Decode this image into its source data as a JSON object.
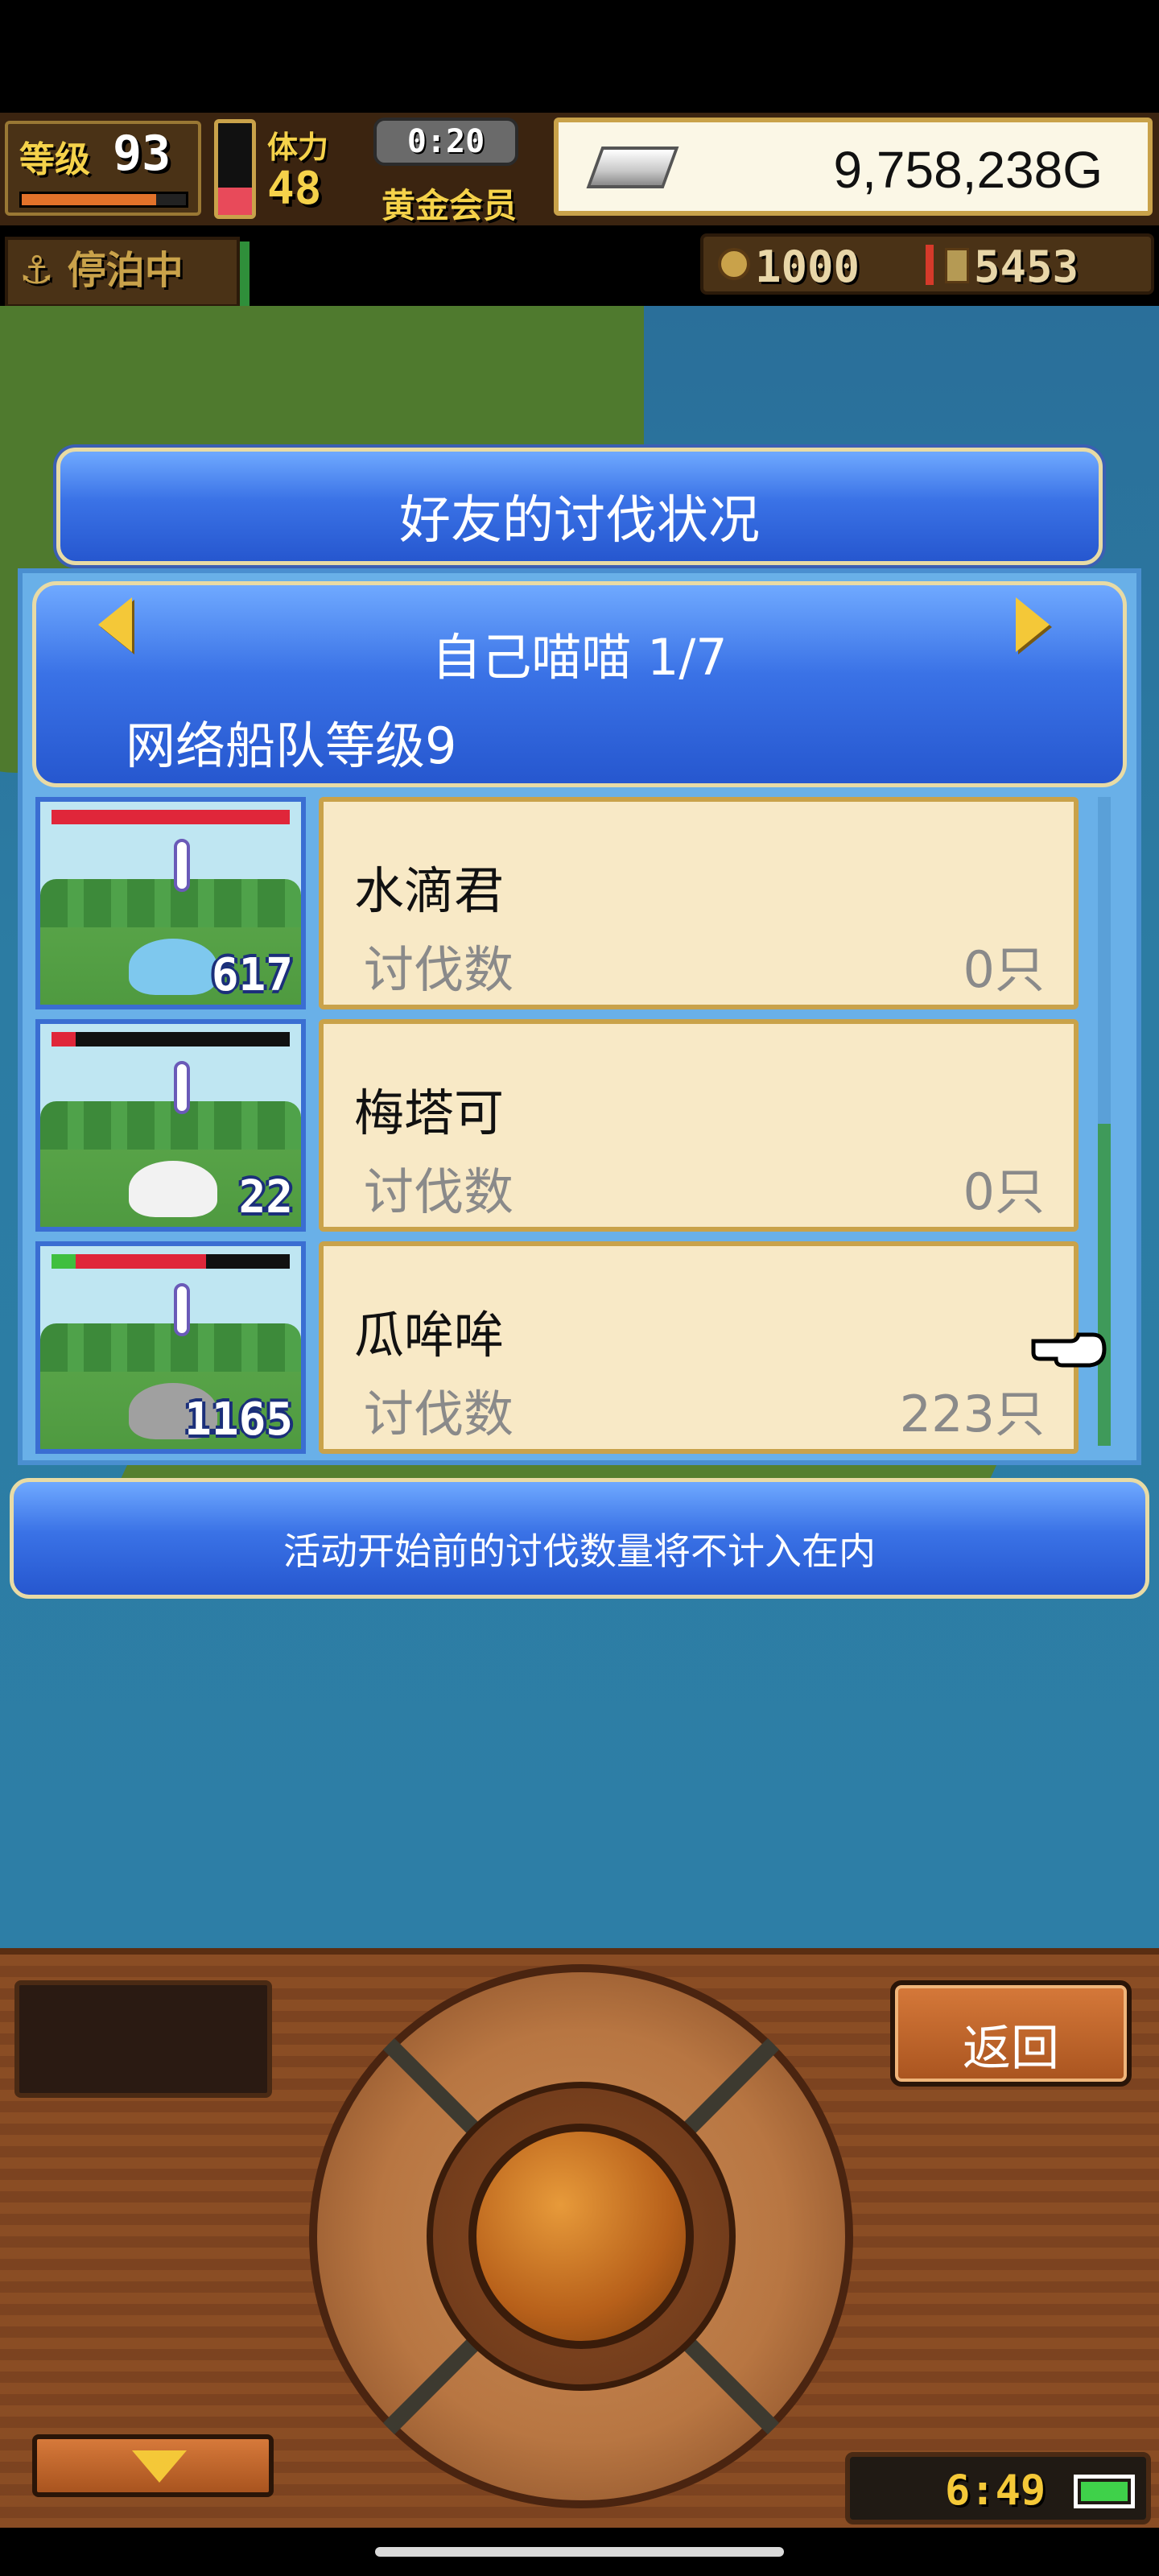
{
  "hud": {
    "level_label": "等级",
    "level": "93",
    "level_progress": 0.82,
    "stamina_label": "体力",
    "stamina": "48",
    "stamina_gauge": 0.3,
    "timer": "0:20",
    "membership": "黄金会员",
    "gold": "9,758,238G",
    "anchored": "停泊中",
    "resource_a": "1000",
    "resource_b": "5453"
  },
  "dialog": {
    "title": "好友的讨伐状况",
    "friend_name": "自己喵喵 1/7",
    "fleet_level": "网络船队等级9",
    "count_label": "讨伐数",
    "notice": "活动开始前的讨伐数量将不计入在内",
    "rows": [
      {
        "name": "水滴君",
        "count": "0只",
        "thumb_count": "617",
        "hp": 1.0,
        "hp_green": 0.0,
        "monster_color": "#7ec8ee"
      },
      {
        "name": "梅塔可",
        "count": "0只",
        "thumb_count": "22",
        "hp": 0.1,
        "hp_green": 0.0,
        "monster_color": "#f2f2f2"
      },
      {
        "name": "瓜哞哞",
        "count": "223只",
        "thumb_count": "1165",
        "hp": 0.55,
        "hp_green": 0.1,
        "monster_color": "#a0a0a0"
      }
    ]
  },
  "panel": {
    "back_label": "返回",
    "clock": "6:49"
  }
}
